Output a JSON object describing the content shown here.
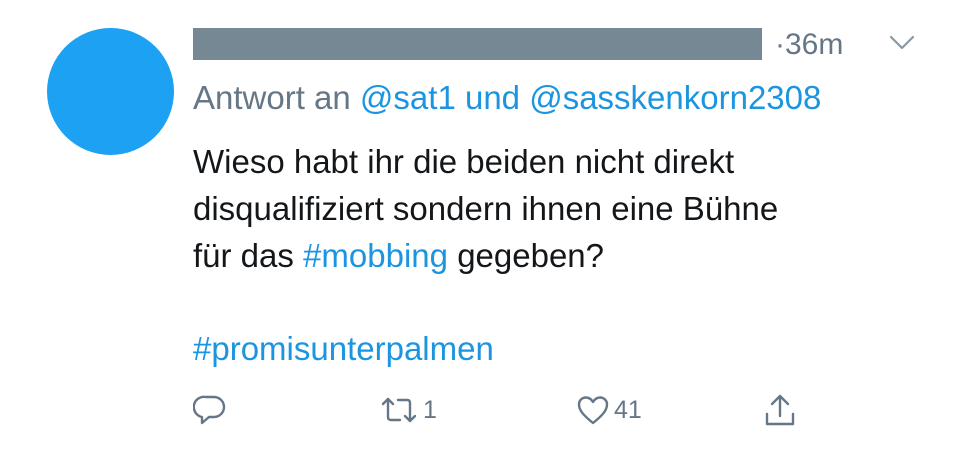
{
  "tweet": {
    "time": "36m",
    "separator": "·",
    "reply_prefix": "Antwort an",
    "reply_user1": "@sat1",
    "reply_conj": "und",
    "reply_user2": "@sasskenkorn2308",
    "text_line1": "Wieso habt ihr die beiden nicht direkt",
    "text_line2": "disqualifiziert sondern ihnen eine Bühne",
    "text_line3_a": "für das",
    "hashtag_inline": "#mobbing",
    "text_line3_b": "gegeben?",
    "hashtag_footer": "#promisunterpalmen",
    "retweet_count": "1",
    "like_count": "41"
  },
  "colors": {
    "avatar": "#1da1f2",
    "redacted_name": "#778895",
    "link": "#1b95e0",
    "meta_text": "#657786",
    "body_text": "#14171a"
  },
  "icons": [
    "reply-icon",
    "retweet-icon",
    "like-icon",
    "share-icon",
    "chevron-down-icon"
  ]
}
